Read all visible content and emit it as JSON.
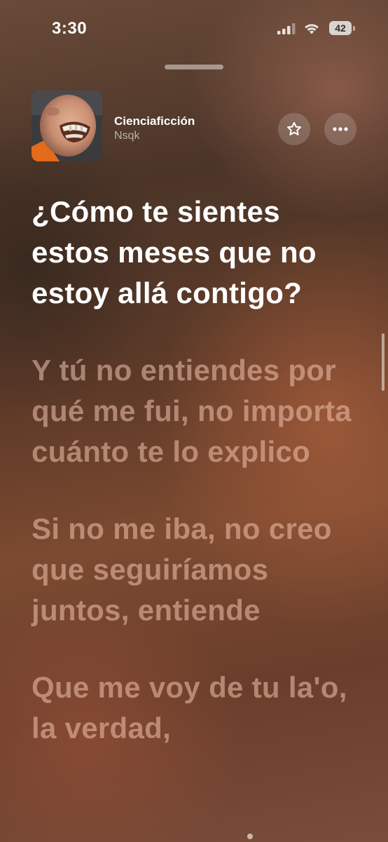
{
  "status_bar": {
    "time": "3:30",
    "battery_level": "42",
    "icons": [
      "signal-icon",
      "wifi-icon",
      "battery-icon"
    ]
  },
  "track": {
    "title": "Cienciaficción",
    "artist": "Nsqk",
    "favorite_icon": "star-icon",
    "more_icon": "ellipsis-icon"
  },
  "lyrics": [
    {
      "text": "¿Cómo te sientes estos meses que no estoy allá contigo?",
      "state": "active"
    },
    {
      "text": "Y tú no entiendes por qué me fui, no importa cuánto te lo explico",
      "state": "upcoming"
    },
    {
      "text": "Si no me iba, no creo que seguiríamos juntos, entiende",
      "state": "upcoming"
    },
    {
      "text": "Que me voy de tu la'o, la verdad,",
      "state": "upcoming"
    }
  ],
  "colors": {
    "active_lyric": "#ffffff",
    "upcoming_lyric": "#f0c3af"
  }
}
